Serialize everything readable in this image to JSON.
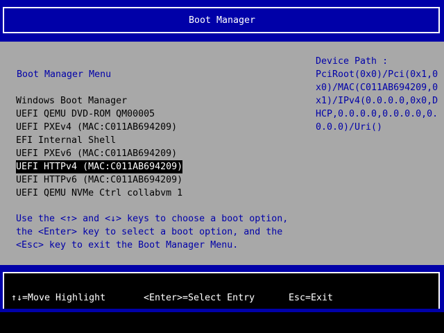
{
  "header": {
    "title": "Boot Manager"
  },
  "menu": {
    "heading": "Boot Manager Menu",
    "items": [
      {
        "label": "Windows Boot Manager",
        "selected": false
      },
      {
        "label": "UEFI QEMU DVD-ROM QM00005",
        "selected": false
      },
      {
        "label": "UEFI PXEv4 (MAC:C011AB694209)",
        "selected": false
      },
      {
        "label": "EFI Internal Shell",
        "selected": false
      },
      {
        "label": "UEFI PXEv6 (MAC:C011AB694209)",
        "selected": false
      },
      {
        "label": "UEFI HTTPv4 (MAC:C011AB694209)",
        "selected": true
      },
      {
        "label": "UEFI HTTPv6 (MAC:C011AB694209)",
        "selected": false
      },
      {
        "label": "UEFI QEMU NVMe Ctrl collabvm 1",
        "selected": false
      }
    ]
  },
  "help": {
    "lines": [
      "Use the <↑> and <↓> keys to choose a boot option,",
      "the <Enter> key to select a boot option, and the",
      "<Esc> key to exit the Boot Manager Menu."
    ]
  },
  "device_path": {
    "lines": [
      "Device Path :",
      "PciRoot(0x0)/Pci(0x1,0",
      "x0)/MAC(C011AB694209,0",
      "x1)/IPv4(0.0.0.0,0x0,D",
      "HCP,0.0.0.0,0.0.0.0,0.",
      "0.0.0)/Uri()"
    ]
  },
  "footer": {
    "move": "↑↓=Move Highlight",
    "select": "<Enter>=Select Entry",
    "exit": "Esc=Exit"
  },
  "colors": {
    "bar_blue": "#0000a8",
    "panel_grey": "#a8a8a8",
    "text_blue": "#0000a8",
    "highlight_bg": "#000000",
    "highlight_fg": "#ffffff"
  }
}
